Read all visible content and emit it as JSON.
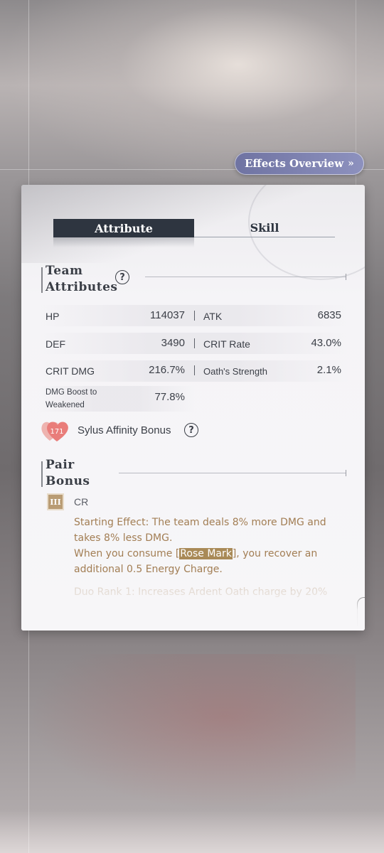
{
  "header": {
    "effects_overview_label": "Effects Overview",
    "effects_overview_chevron": "»"
  },
  "tabs": [
    {
      "label": "Attribute",
      "active": true
    },
    {
      "label": "Skill",
      "active": false
    }
  ],
  "team_attributes": {
    "title_line1": "Team",
    "title_line2": "Attributes",
    "help_glyph": "?",
    "stats": [
      {
        "name": "HP",
        "value": "114037"
      },
      {
        "name": "ATK",
        "value": "6835"
      },
      {
        "name": "DEF",
        "value": "3490"
      },
      {
        "name": "CRIT Rate",
        "value": "43.0%"
      },
      {
        "name": "CRIT DMG",
        "value": "216.7%"
      },
      {
        "name": "Oath's Strength",
        "value": "2.1%"
      },
      {
        "name_line1": "DMG Boost to",
        "name_line2": "Weakened",
        "value": "77.8%"
      }
    ]
  },
  "affinity": {
    "level": "171",
    "label": "Sylus Affinity Bonus",
    "help_glyph": "?",
    "heart_color": "#e9877f"
  },
  "pair_bonus": {
    "title_line1": "Pair",
    "title_line2": "Bonus",
    "rank_numeral": "III",
    "rank_name": "CR",
    "effect_line1": "Starting Effect: The team deals 8% more DMG and takes 8% less DMG.",
    "effect_line2_pre": "When you consume [",
    "effect_highlight": "Rose Mark",
    "effect_line2_post": "], you recover an additional 0.5 Energy Charge.",
    "faded_line": "Duo Rank 1: Increases Ardent Oath charge by 20%"
  },
  "colors": {
    "tab_active_bg": "#2e3540",
    "effect_text": "#a27e54",
    "highlight_bg": "#a98a57",
    "button_bg": "#7b7fae"
  }
}
